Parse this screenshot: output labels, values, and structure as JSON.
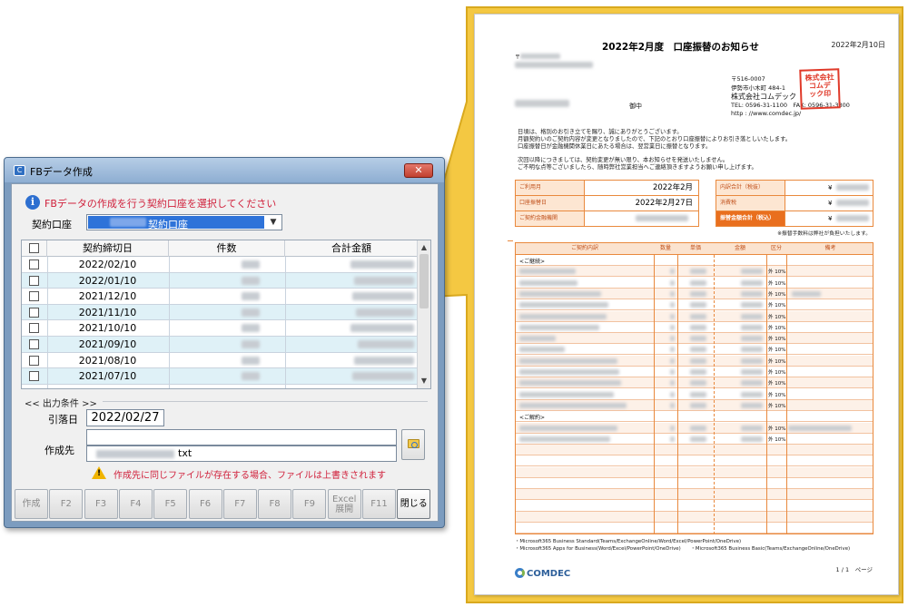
{
  "window": {
    "title": "FBデータ作成",
    "close_label": "✕"
  },
  "instruction": "FBデータの作成を行う契約口座を選択してください",
  "account": {
    "label": "契約口座",
    "selected_value": "契約口座"
  },
  "grid": {
    "columns": [
      "",
      "契約締切日",
      "件数",
      "合計金額"
    ],
    "rows": [
      {
        "date": "2022/02/10"
      },
      {
        "date": "2022/01/10"
      },
      {
        "date": "2021/12/10"
      },
      {
        "date": "2021/11/10"
      },
      {
        "date": "2021/10/10"
      },
      {
        "date": "2021/09/10"
      },
      {
        "date": "2021/08/10"
      },
      {
        "date": "2021/07/10"
      }
    ]
  },
  "output": {
    "header": "<< 出力条件 >>",
    "due_label": "引落日",
    "due_value": "2022/02/27",
    "dest_label": "作成先",
    "dest_value_suffix": "txt",
    "warning": "作成先に同じファイルが存在する場合、ファイルは上書きされます"
  },
  "function_keys": [
    {
      "label": "作成",
      "active": false
    },
    {
      "label": "F2",
      "active": false
    },
    {
      "label": "F3",
      "active": false
    },
    {
      "label": "F4",
      "active": false
    },
    {
      "label": "F5",
      "active": false
    },
    {
      "label": "F6",
      "active": false
    },
    {
      "label": "F7",
      "active": false
    },
    {
      "label": "F8",
      "active": false
    },
    {
      "label": "F9",
      "active": false
    },
    {
      "label": "Excel\n展開",
      "active": false
    },
    {
      "label": "F11",
      "active": false
    },
    {
      "label": "閉じる",
      "active": true
    }
  ],
  "document": {
    "date": "2022年2月10日",
    "title": "2022年2月度　口座振替のお知らせ",
    "postal_prefix": "〒",
    "recipient_suffix": "御中",
    "sender": {
      "postal": "〒516-0007",
      "address": "伊勢市小木町 484-1",
      "company": "株式会社コムデック",
      "tel": "TEL: 0596-31-1100",
      "fax": "FAX: 0596-31-3300",
      "url": "http : //www.comdec.jp/",
      "seal": "株式会社コムデック"
    },
    "message": [
      "日頃は、格別のお引き立てを賜り、誠にありがとうございます。",
      "月額契約いのご契約内容が変更となりましたので、下記のとおり口座振替によりお引き落としいたします。",
      "口座振替日が金融機関休業日にあたる場合は、翌営業日に振替となります。",
      "次回以降につきましては、契約変更が無い限り、本お知らせを発送いたしません。",
      "ご不明な点等ございましたら、随時弊社営業担当へご連絡頂きますようお願い申し上げます。"
    ],
    "summary_left": [
      {
        "label": "ご利用月",
        "value": "2022年2月"
      },
      {
        "label": "口座振替日",
        "value": "2022年2月27日"
      },
      {
        "label": "ご契約金融機関",
        "value": ""
      }
    ],
    "summary_right": [
      {
        "label": "内訳合計（税抜）",
        "value": "¥"
      },
      {
        "label": "消費税",
        "value": "¥"
      },
      {
        "label": "振替金額合計（税込）",
        "value": "¥"
      }
    ],
    "fee_note": "※振替手数料は弊社が負担いたします。",
    "detail_headers": [
      "ご契約内訳",
      "数量",
      "単価",
      "金額",
      "区分",
      "備考"
    ],
    "section_ongoing": "<ご継続>",
    "section_cancel": "<ご解約>",
    "tax_tag": "外 10%",
    "footer1": "・Microsoft365 Business Standard(Teams/ExchangeOnline/Word/Excel/PowerPoint/OneDrive)",
    "footer2": "・Microsoft365 Apps for Business(Word/Excel/PowerPoint/OneDrive)　　・Microsoft365 Business Basic(Teams/ExchangeOnline/OneDrive)",
    "brand": "COMDEC",
    "page": "1 / 1　ページ"
  },
  "colors": {
    "accent_orange": "#e9893d",
    "callout_yellow": "#f4c842",
    "warning_red": "#d01f3a",
    "selection_blue": "#2e73d9"
  }
}
